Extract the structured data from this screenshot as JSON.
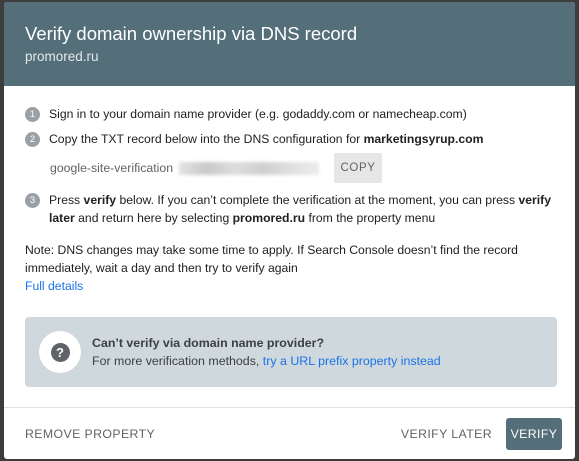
{
  "dialog": {
    "title": "Verify domain ownership via DNS record",
    "subtitle": "promored.ru"
  },
  "steps": [
    {
      "num": "1",
      "text": "Sign in to your domain name provider (e.g. godaddy.com or namecheap.com)"
    },
    {
      "num": "2",
      "text_before": "Copy the TXT record below into the DNS configuration for ",
      "domain": "marketingsyrup.com"
    },
    {
      "num": "3",
      "p1": "Press ",
      "verify_word": "verify",
      "p2": " below. If you can’t complete the verification at the moment, you can press ",
      "verify_later_word": "verify later",
      "p3": " and return here by selecting ",
      "property": "promored.ru",
      "p4": " from the property menu"
    }
  ],
  "record": {
    "value_prefix": "google-site-verification",
    "copy_label": "COPY"
  },
  "note": {
    "text": "Note: DNS changes may take some time to apply. If Search Console doesn’t find the record immediately, wait a day and then try to verify again",
    "link": "Full details"
  },
  "alternative": {
    "title": "Can’t verify via domain name provider?",
    "text": "For more verification methods, ",
    "link": "try a URL prefix property instead",
    "icon": "help-icon"
  },
  "footer": {
    "remove_label": "REMOVE PROPERTY",
    "later_label": "VERIFY LATER",
    "verify_label": "VERIFY"
  },
  "colors": {
    "header_bg": "#546e7a",
    "link": "#1a73e8",
    "alt_box_bg": "#cfd8dc"
  }
}
